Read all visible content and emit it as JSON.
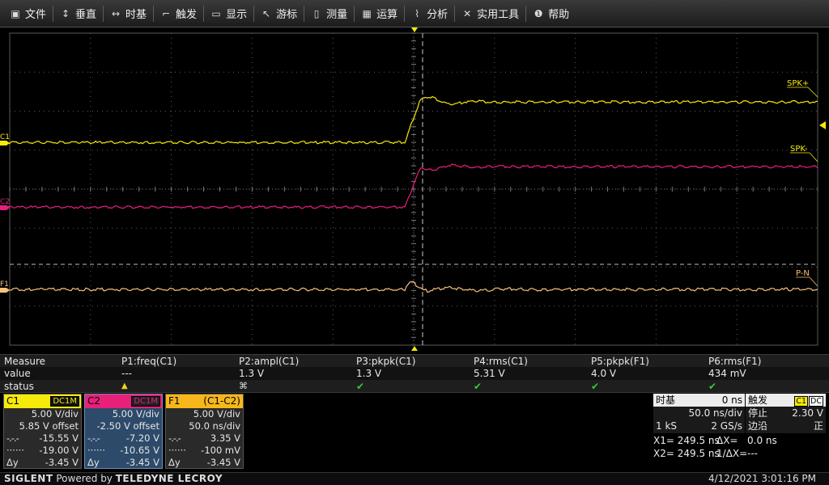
{
  "menu": [
    {
      "label": "文件",
      "icon": "save-icon"
    },
    {
      "label": "垂直",
      "icon": "vertical-arrow-icon"
    },
    {
      "label": "时基",
      "icon": "horizontal-arrow-icon"
    },
    {
      "label": "触发",
      "icon": "trigger-icon"
    },
    {
      "label": "显示",
      "icon": "display-icon"
    },
    {
      "label": "游标",
      "icon": "cursor-icon"
    },
    {
      "label": "测量",
      "icon": "measure-icon"
    },
    {
      "label": "运算",
      "icon": "math-icon"
    },
    {
      "label": "分析",
      "icon": "analysis-icon"
    },
    {
      "label": "实用工具",
      "icon": "tools-icon"
    },
    {
      "label": "帮助",
      "icon": "help-icon"
    }
  ],
  "traces": {
    "labels": {
      "c1": "C1",
      "c2": "C2",
      "f1": "F1"
    },
    "spk_plus": "SPK+",
    "spk_minus": "SPK-",
    "p_n": "P-N",
    "colors": {
      "c1": "#f5ea0a",
      "c2": "#e8207a",
      "f1": "#f5c27a",
      "grid": "#5a5a5a",
      "cursor": "#cccccc"
    }
  },
  "measure": {
    "headers": [
      "Measure",
      "P1:freq(C1)",
      "P2:ampl(C1)",
      "P3:pkpk(C1)",
      "P4:rms(C1)",
      "P5:pkpk(F1)",
      "P6:rms(F1)"
    ],
    "value_label": "value",
    "values": [
      "---",
      "1.3 V",
      "1.3 V",
      "5.31 V",
      "4.0 V",
      "434 mV"
    ],
    "status_label": "status",
    "status_icons": [
      "warning-icon",
      "x-icon",
      "check-icon",
      "check-icon",
      "check-icon",
      "check-icon"
    ]
  },
  "channels": {
    "c1": {
      "name": "C1",
      "coupling": "DC1M",
      "vdiv": "5.00 V/div",
      "offset": "5.85 V offset",
      "row3_left": "-.-.-",
      "row3": "-15.55 V",
      "row4_left": "······",
      "row4": "-19.00 V",
      "delta_label": "Δy",
      "delta": "-3.45 V"
    },
    "c2": {
      "name": "C2",
      "coupling": "DC1M",
      "vdiv": "5.00 V/div",
      "offset": "-2.50 V offset",
      "row3_left": "-.-.-",
      "row3": "-7.20 V",
      "row4_left": "······",
      "row4": "-10.65 V",
      "delta_label": "Δy",
      "delta": "-3.45 V"
    },
    "f1": {
      "name": "F1",
      "func": "(C1-C2)",
      "vdiv": "5.00 V/div",
      "tdiv": "50.0 ns/div",
      "row3_left": "-.-.-",
      "row3": "3.35 V",
      "row4_left": "······",
      "row4": "-100 mV",
      "delta_label": "Δy",
      "delta": "-3.45 V"
    }
  },
  "timebase": {
    "title": "时基",
    "delay": "0 ns",
    "tdiv": "50.0 ns/div",
    "samples": "1 kS",
    "rate": "2 GS/s"
  },
  "trigger": {
    "title": "触发",
    "source": "C1",
    "coupling": "DC",
    "mode": "停止",
    "level": "2.30 V",
    "type": "边沿",
    "slope": "正"
  },
  "cursors": {
    "x1": "X1= 249.5 ns",
    "dx": "ΔX=",
    "dx_val": "0.0 ns",
    "x2": "X2= 249.5 ns",
    "inv_dx": "1/ΔX=",
    "inv_dx_val": "---"
  },
  "footer": {
    "brand_a": "SIGLENT",
    "brand_b": "Powered by",
    "brand_c": "TELEDYNE LECROY",
    "timestamp": "4/12/2021 3:01:16 PM"
  }
}
